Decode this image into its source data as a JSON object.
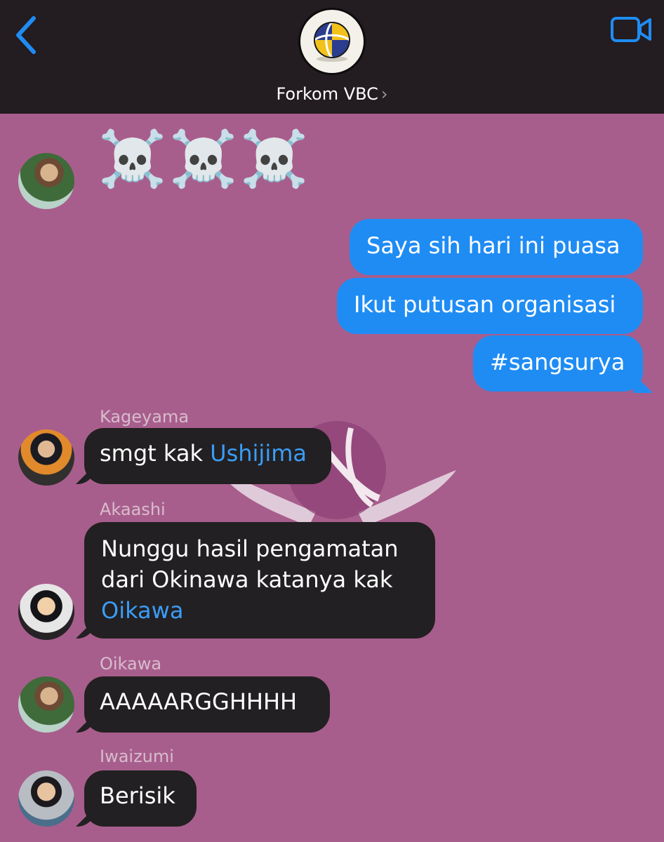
{
  "header": {
    "group_name": "Forkom VBC",
    "chevron": "›",
    "back_icon": "chevron-left-icon",
    "video_icon": "video-camera-icon",
    "accent": "#1f8cf4"
  },
  "messages": [
    {
      "sender": "",
      "text": "☠️☠️☠️"
    },
    {
      "direction": "out",
      "text": "Saya sih hari ini puasa"
    },
    {
      "direction": "out",
      "text": "Ikut putusan organisasi"
    },
    {
      "direction": "out",
      "text": "#sangsurya"
    },
    {
      "sender": "Kageyama",
      "text": "smgt kak ",
      "mention": "Ushijima"
    },
    {
      "sender": "Akaashi",
      "line1": "Nunggu hasil pengamatan",
      "line2": "dari Okinawa katanya kak",
      "mention": "Oikawa"
    },
    {
      "sender": "Oikawa",
      "text": "AAAAARGGHHHH"
    },
    {
      "sender": "Iwaizumi",
      "text": "Berisik"
    }
  ]
}
